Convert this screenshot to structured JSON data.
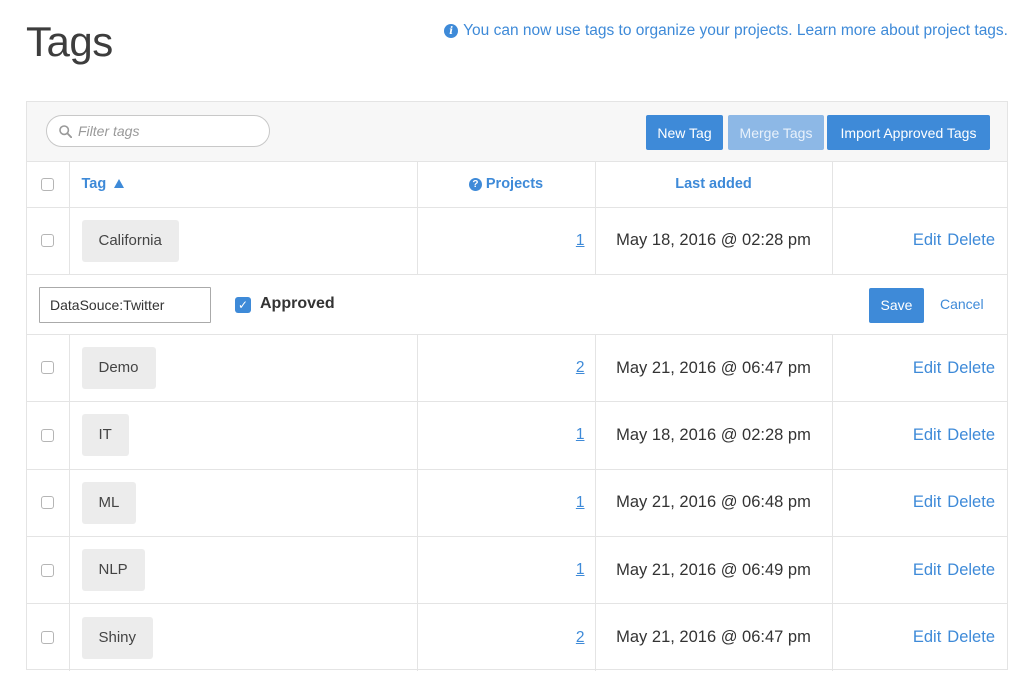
{
  "page": {
    "title": "Tags"
  },
  "info_banner": {
    "text": "You can now use tags to organize your projects.",
    "link": "Learn more about project tags."
  },
  "toolbar": {
    "filter_placeholder": "Filter tags",
    "new_tag_label": "New Tag",
    "merge_tags_label": "Merge Tags",
    "import_label": "Import Approved Tags"
  },
  "table": {
    "headers": {
      "tag": "Tag",
      "projects": "Projects",
      "last_added": "Last added"
    },
    "rows": [
      {
        "tag": "California",
        "projects": "1",
        "last_added": "May 18, 2016 @ 02:28 pm",
        "edit": "Edit",
        "delete": "Delete"
      },
      {
        "tag": "Demo",
        "projects": "2",
        "last_added": "May 21, 2016 @ 06:47 pm",
        "edit": "Edit",
        "delete": "Delete"
      },
      {
        "tag": "IT",
        "projects": "1",
        "last_added": "May 18, 2016 @ 02:28 pm",
        "edit": "Edit",
        "delete": "Delete"
      },
      {
        "tag": "ML",
        "projects": "1",
        "last_added": "May 21, 2016 @ 06:48 pm",
        "edit": "Edit",
        "delete": "Delete"
      },
      {
        "tag": "NLP",
        "projects": "1",
        "last_added": "May 21, 2016 @ 06:49 pm",
        "edit": "Edit",
        "delete": "Delete"
      },
      {
        "tag": "Shiny",
        "projects": "2",
        "last_added": "May 21, 2016 @ 06:47 pm",
        "edit": "Edit",
        "delete": "Delete"
      }
    ],
    "edit_row": {
      "value": "DataSouce:Twitter",
      "approved_label": "Approved",
      "approved_checked": true,
      "save_label": "Save",
      "cancel_label": "Cancel"
    }
  },
  "colors": {
    "accent": "#3e8ad8",
    "accent_disabled": "#8db8e6",
    "pill_bg": "#ececec"
  }
}
